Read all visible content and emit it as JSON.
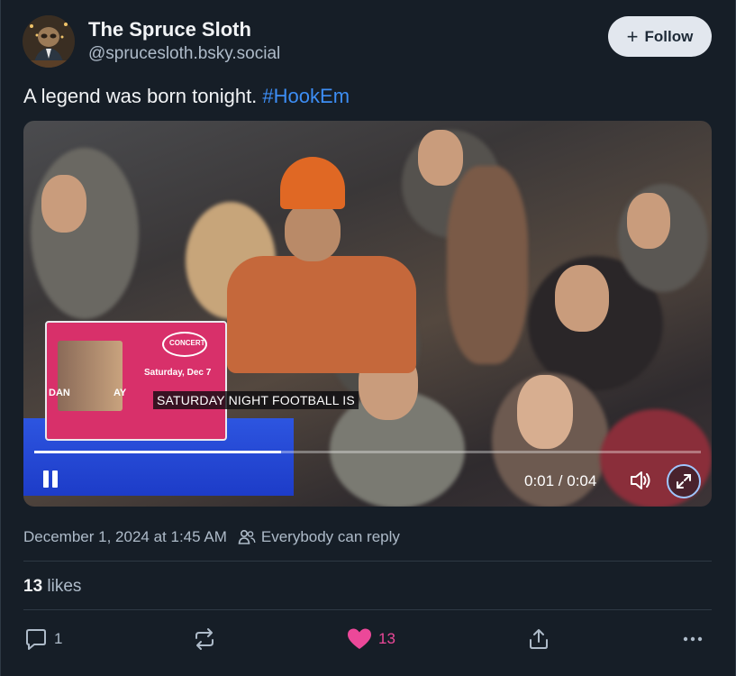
{
  "author": {
    "display_name": "The Spruce Sloth",
    "handle": "@sprucesloth.bsky.social"
  },
  "follow_button": {
    "label": "Follow"
  },
  "post": {
    "text": "A legend was born tonight. ",
    "hashtag": "#HookEm"
  },
  "video": {
    "overlay_ad": {
      "headline": "CONCERT",
      "date_text": "Saturday, Dec 7",
      "name_left": "DAN",
      "name_right": "AY"
    },
    "caption": "SATURDAY NIGHT FOOTBALL IS",
    "current_time": "0:01",
    "duration": "0:04",
    "time_display": "0:01 / 0:04",
    "progress_fraction": 0.37,
    "state": "playing"
  },
  "meta": {
    "timestamp": "December 1, 2024 at 1:45 AM",
    "reply_setting": "Everybody can reply"
  },
  "stats": {
    "likes_count": "13",
    "likes_label": "likes"
  },
  "actions": {
    "reply_count": "1",
    "like_count": "13"
  },
  "colors": {
    "background": "#161e27",
    "link": "#3d8ef5",
    "like_active": "#ec4899",
    "muted_text": "#aebbc9",
    "follow_bg": "#e2e7ee"
  },
  "icons": [
    "avatar",
    "plus-icon",
    "pause-icon",
    "volume-icon",
    "fullscreen-icon",
    "people-icon",
    "reply-icon",
    "repost-icon",
    "heart-icon",
    "share-icon",
    "more-icon"
  ]
}
